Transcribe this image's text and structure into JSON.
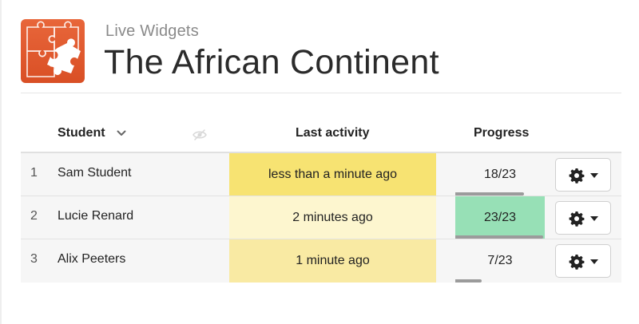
{
  "header": {
    "subtitle": "Live Widgets",
    "title": "The African Continent",
    "logo_icon": "puzzle-icon",
    "accent": "#e0592e"
  },
  "table": {
    "columns": {
      "student": "Student",
      "last_activity": "Last activity",
      "progress": "Progress"
    },
    "rows": [
      {
        "num": "1",
        "name": "Sam Student",
        "last_activity": "less than a minute ago",
        "activity_color": "#f7e372",
        "progress_text": "18/23",
        "progress_fraction": 0.7826,
        "progress_complete": false
      },
      {
        "num": "2",
        "name": "Lucie Renard",
        "last_activity": "2 minutes ago",
        "activity_color": "#fdf6cf",
        "progress_text": "23/23",
        "progress_fraction": 1.0,
        "progress_complete": true
      },
      {
        "num": "3",
        "name": "Alix Peeters",
        "last_activity": "1 minute ago",
        "activity_color": "#f9eaa3",
        "progress_text": "7/23",
        "progress_fraction": 0.3043,
        "progress_complete": false
      }
    ]
  },
  "colors": {
    "progress_complete": "#97e0b6",
    "progress_bar": "#9b9b9b"
  }
}
